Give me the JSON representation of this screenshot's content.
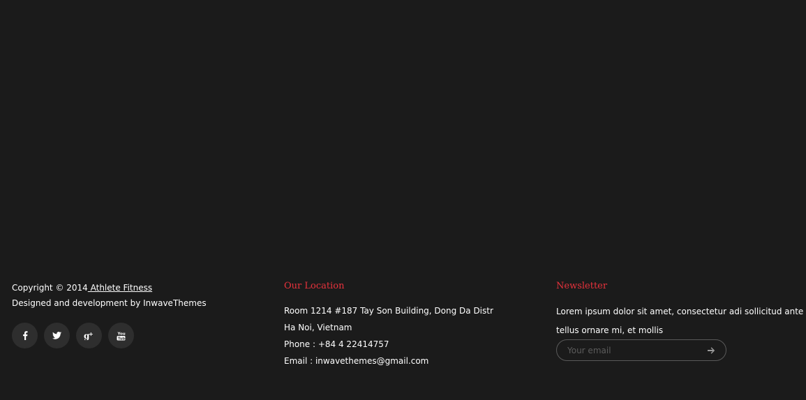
{
  "footer": {
    "copyright_prefix": "Copyright © 2014",
    "copyright_link": " Athlete Fitness",
    "credit": "Designed and development by InwaveThemes",
    "social": [
      {
        "icon": "facebook-icon"
      },
      {
        "icon": "twitter-icon"
      },
      {
        "icon": "google-plus-icon"
      },
      {
        "icon": "youtube-icon"
      }
    ],
    "location": {
      "title": "Our Location",
      "address_line1": "Room 1214  #187 Tay Son Building, Dong Da Distr",
      "address_line2": "Ha Noi, Vietnam",
      "phone": "Phone : +84 4 22414757",
      "email": "Email : inwavethemes@gmail.com"
    },
    "newsletter": {
      "title": "Newsletter",
      "text_line1": "Lorem ipsum dolor sit amet, consectetur adi sollicitud ante",
      "text_line2": "tellus ornare mi, et mollis",
      "placeholder": "Your email",
      "submit_icon": "arrow-right-icon"
    }
  },
  "colors": {
    "background": "#1b1b1b",
    "accent": "#e8323c",
    "social_button": "#2e2e2e"
  }
}
